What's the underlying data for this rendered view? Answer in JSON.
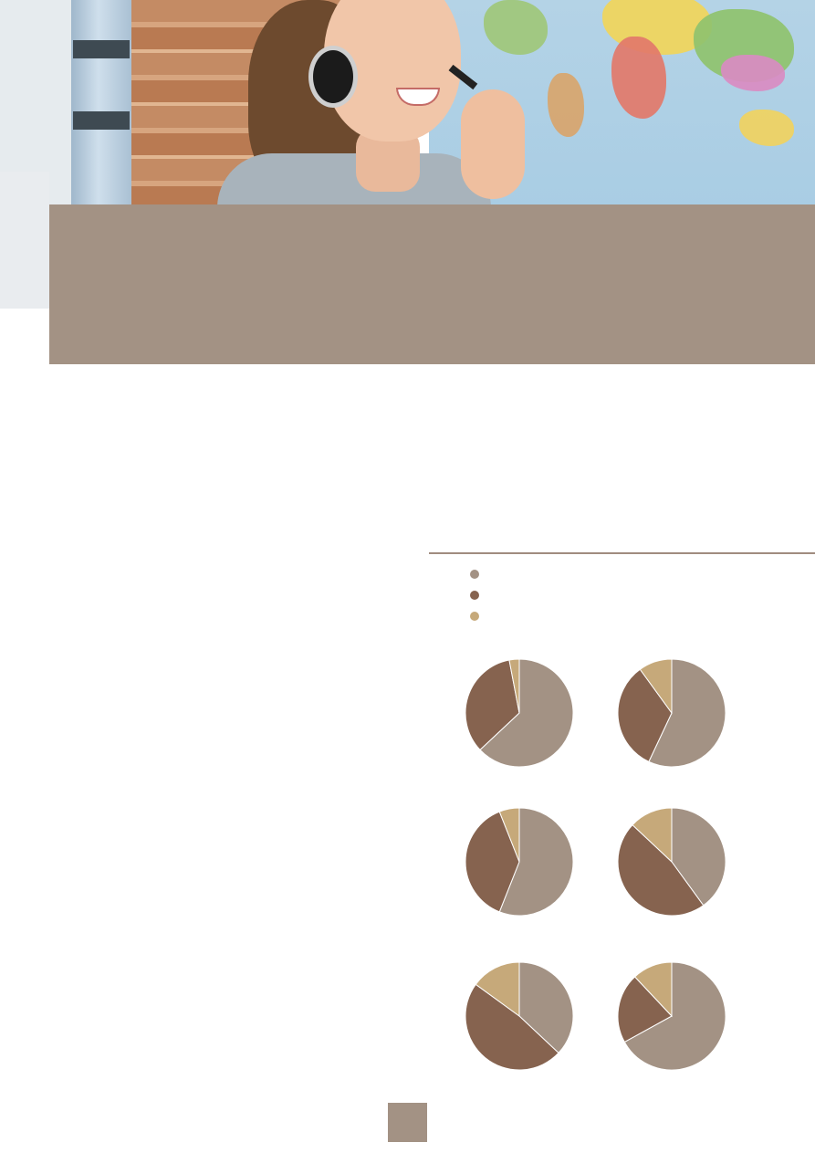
{
  "title_band": {
    "title": ""
  },
  "legend": [
    {
      "label": "",
      "color": "#a39284"
    },
    {
      "label": "",
      "color": "#86634f"
    },
    {
      "label": "",
      "color": "#c6a97a"
    }
  ],
  "colors": {
    "accent": "#a39284",
    "rule": "#a08c7f"
  },
  "chart_data": {
    "type": "pie",
    "charts": [
      {
        "title": "",
        "values": [
          63,
          34,
          3
        ]
      },
      {
        "title": "",
        "values": [
          57,
          33,
          10
        ]
      },
      {
        "title": "",
        "values": [
          56,
          38,
          6
        ]
      },
      {
        "title": "",
        "values": [
          40,
          47,
          13
        ]
      },
      {
        "title": "",
        "values": [
          37,
          48,
          15
        ]
      },
      {
        "title": "",
        "values": [
          67,
          21,
          12
        ]
      }
    ],
    "colors": [
      "#a39284",
      "#86634f",
      "#c6a97a"
    ]
  },
  "page": {
    "number": ""
  }
}
